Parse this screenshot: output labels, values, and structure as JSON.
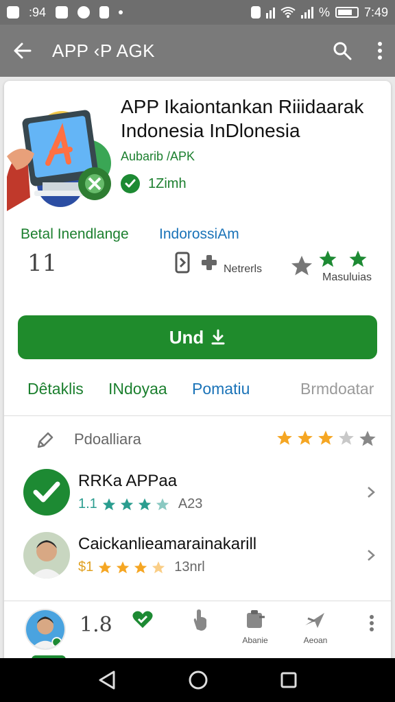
{
  "status_bar": {
    "left_text": ":94",
    "time": "7:49",
    "battery_pct_symbol": "%"
  },
  "app_bar": {
    "title": "APP ‹P AGK",
    "back_icon": "arrow-left-icon",
    "search_icon": "search-icon",
    "more_icon": "more-vert-icon"
  },
  "app": {
    "title": "APP Ikaiontankan Riiidaarak Indonesia InDlonesia",
    "developer": "Aubarib /APK",
    "installs": "1Zimh",
    "meta_left": "Betal Inendlange",
    "meta_right": "IndorossiAm",
    "stat_number": "11",
    "stat_mid_label": "Netrerls",
    "stat_right_label": "Masuluias",
    "install_label": "Und",
    "accent_green": "#1f8b2c"
  },
  "tabs": [
    {
      "label": "Dêtaklis"
    },
    {
      "label": "INdoyaa"
    },
    {
      "label": "Pomatiu"
    },
    {
      "label": "Brmdoatar"
    }
  ],
  "rating_row": {
    "label": "Pdoalliara",
    "stars_filled": 3,
    "stars_total": 5
  },
  "list": [
    {
      "title": "RRKa APPaa",
      "rating": "1.1",
      "stars_filled": 3.5,
      "count": "A23"
    },
    {
      "title": "Caickanlieamarainakarill",
      "rating": "$1",
      "stars_filled": 3.5,
      "count": "13nrl"
    }
  ],
  "bottom_bar": {
    "number": "1.8",
    "item3_label": "Abanie",
    "item4_label": "Aeoan"
  }
}
